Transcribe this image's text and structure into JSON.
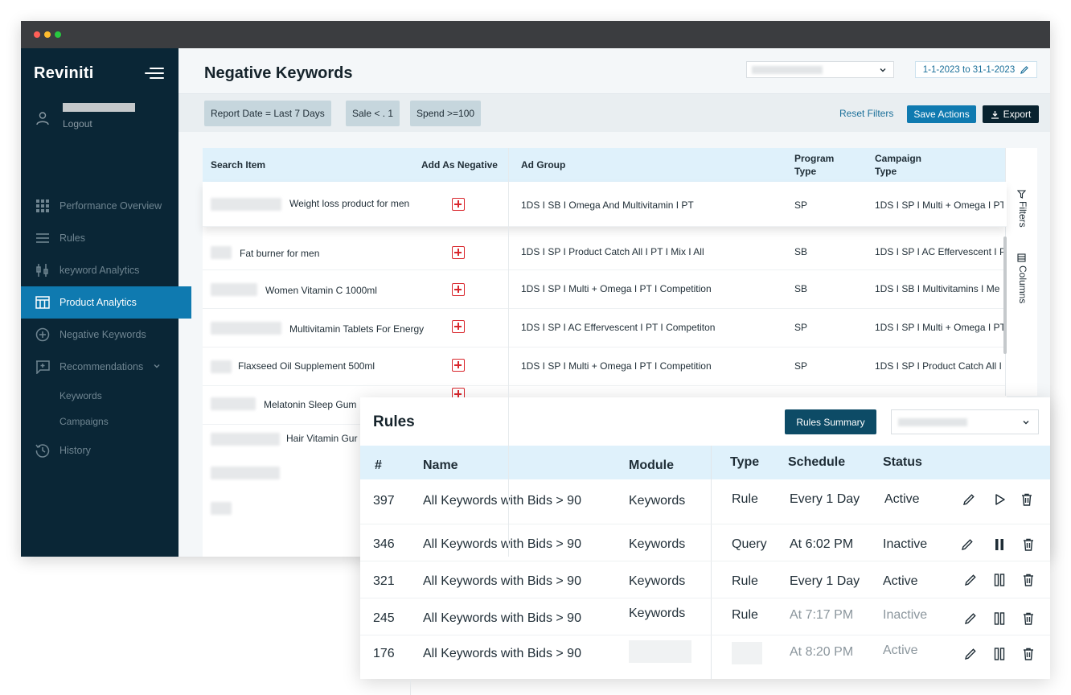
{
  "app": {
    "brand": "Reviniti",
    "user": {
      "logout_label": "Logout"
    }
  },
  "sidebar": {
    "items": [
      {
        "label": "Performance Overview",
        "icon": "grid-icon"
      },
      {
        "label": "Rules",
        "icon": "list-icon"
      },
      {
        "label": "keyword Analytics",
        "icon": "sliders-icon"
      },
      {
        "label": "Product Analytics",
        "icon": "table-icon",
        "active": true
      },
      {
        "label": "Negative Keywords",
        "icon": "plus-circle-icon"
      },
      {
        "label": "Recommendations",
        "icon": "recommend-icon",
        "expandable": true
      },
      {
        "label": "History",
        "icon": "history-icon"
      }
    ],
    "sub_items": [
      "Keywords",
      "Campaigns"
    ]
  },
  "header": {
    "title": "Negative Keywords",
    "date_range": "1-1-2023 to 31-1-2023"
  },
  "filters": {
    "chips": [
      "Report Date = Last 7 Days",
      "Sale < . 1",
      "Spend >=100"
    ],
    "reset_label": "Reset Filters",
    "save_label": "Save Actions",
    "export_label": "Export"
  },
  "table": {
    "columns": [
      "Search Item",
      "Add As Negative",
      "Ad Group",
      "Program Type",
      "Campaign Type"
    ],
    "rows": [
      {
        "search_item": "Weight loss product for men",
        "ad_group": "1DS I SB I Omega And Multivitamin I PT",
        "program_type": "SP",
        "campaign_type": "1DS I SP I Multi + Omega I PT I"
      },
      {
        "search_item": "Fat burner for men",
        "ad_group": "1DS I SP I Product Catch All I PT I Mix I All",
        "program_type": "SB",
        "campaign_type": "1DS I SP I AC Effervescent I PT"
      },
      {
        "search_item": "Women Vitamin C 1000ml",
        "ad_group": "1DS I SP I Multi + Omega I PT I Competition",
        "program_type": "SB",
        "campaign_type": "1DS I SB I Multivitamins I Me"
      },
      {
        "search_item": "Multivitamin Tablets For Energy",
        "ad_group": "1DS I SP I AC Effervescent I PT I Competiton",
        "program_type": "SP",
        "campaign_type": "1DS I SP I Multi + Omega I PT I"
      },
      {
        "search_item": "Flaxseed Oil Supplement 500ml",
        "ad_group": "1DS I SP I Multi + Omega I PT I Competition",
        "program_type": "SP",
        "campaign_type": "1DS I SP I Product Catch All I"
      },
      {
        "search_item": "Melatonin Sleep Gum",
        "ad_group": "",
        "program_type": "",
        "campaign_type": ""
      },
      {
        "search_item": "Hair Vitamin Gur",
        "ad_group": "",
        "program_type": "",
        "campaign_type": ""
      }
    ],
    "side_tabs": [
      "Filters",
      "Columns"
    ]
  },
  "rules_panel": {
    "title": "Rules",
    "summary_button": "Rules Summary",
    "columns": [
      "#",
      "Name",
      "Module",
      "Type",
      "Schedule",
      "Status"
    ],
    "rows": [
      {
        "id": "397",
        "name": "All Keywords with Bids > 90",
        "module": "Keywords",
        "type": "Rule",
        "schedule": "Every 1 Day",
        "status": "Active",
        "action": "play-icon"
      },
      {
        "id": "346",
        "name": "All Keywords with Bids > 90",
        "module": "Keywords",
        "type": "Query",
        "schedule": "At 6:02 PM",
        "status": "Inactive",
        "action": "pause-icon"
      },
      {
        "id": "321",
        "name": "All Keywords with Bids > 90",
        "module": "Keywords",
        "type": "Rule",
        "schedule": "Every 1 Day",
        "status": "Active",
        "action": "pause-outline-icon"
      },
      {
        "id": "245",
        "name": "All Keywords with Bids > 90",
        "module": "Keywords",
        "type": "Rule",
        "schedule": "At 7:17 PM",
        "status": "Inactive",
        "action": "pause-outline-icon"
      },
      {
        "id": "176",
        "name": "All Keywords with Bids > 90",
        "module": "",
        "type": "",
        "schedule": "At 8:20 PM",
        "status": "Active",
        "action": "pause-outline-icon"
      }
    ]
  },
  "colors": {
    "sidebar_bg": "#0a2636",
    "accent": "#0f7ab0",
    "header_row": "#dff1fb",
    "danger": "#d9262c"
  }
}
